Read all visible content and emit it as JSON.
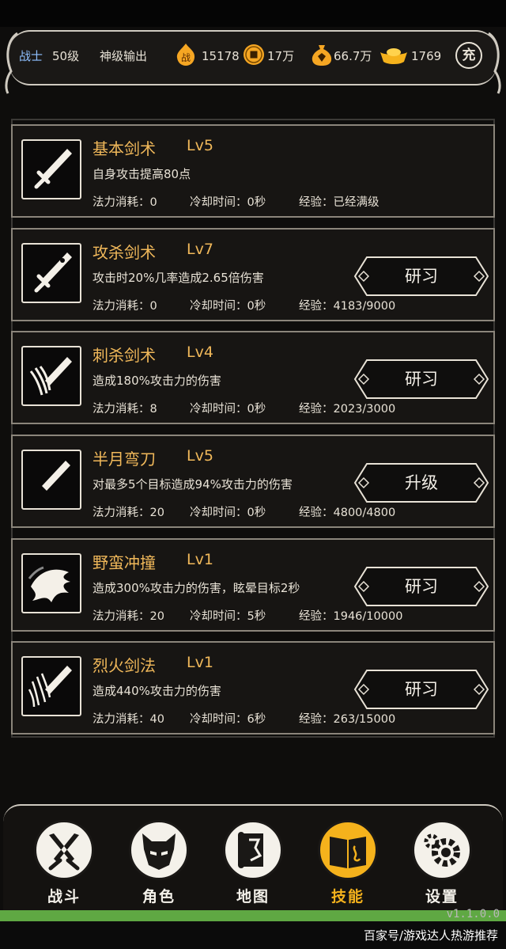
{
  "header": {
    "class": "战士",
    "level": "50级",
    "title": "神级输出",
    "battle_icon": "battle-power-icon",
    "battle_glyph": "战",
    "battle_power": "15178",
    "coin_icon": "coin-icon",
    "coins": "17万",
    "gem_icon": "gem-bag-icon",
    "gems": "66.7万",
    "ingot_icon": "gold-ingot-icon",
    "ingots": "1769",
    "recharge_label": "充"
  },
  "labels": {
    "mp": "法力消耗：",
    "cd": "冷却时间：",
    "exp": "经验："
  },
  "skills": [
    {
      "name": "基本剑术",
      "level": "Lv5",
      "desc": "自身攻击提高80点",
      "mp": "法力消耗：0",
      "cd": "冷却时间：0秒",
      "exp": "经验：已经满级",
      "button": "",
      "icon": "basic-sword-icon"
    },
    {
      "name": "攻杀剑术",
      "level": "Lv7",
      "desc": "攻击时20%几率造成2.65倍伤害",
      "mp": "法力消耗：0",
      "cd": "冷却时间：0秒",
      "exp": "经验：4183/9000",
      "button": "研习",
      "icon": "slaying-sword-icon"
    },
    {
      "name": "刺杀剑术",
      "level": "Lv4",
      "desc": "造成180%攻击力的伤害",
      "mp": "法力消耗：8",
      "cd": "冷却时间：0秒",
      "exp": "经验：2023/3000",
      "button": "研习",
      "icon": "thrust-sword-icon"
    },
    {
      "name": "半月弯刀",
      "level": "Lv5",
      "desc": "对最多5个目标造成94%攻击力的伤害",
      "mp": "法力消耗：20",
      "cd": "冷却时间：0秒",
      "exp": "经验：4800/4800",
      "button": "升级",
      "icon": "half-moon-blade-icon"
    },
    {
      "name": "野蛮冲撞",
      "level": "Lv1",
      "desc": "造成300%攻击力的伤害，眩晕目标2秒",
      "mp": "法力消耗：20",
      "cd": "冷却时间：5秒",
      "exp": "经验：1946/10000",
      "button": "研习",
      "icon": "barbaric-charge-icon"
    },
    {
      "name": "烈火剑法",
      "level": "Lv1",
      "desc": "造成440%攻击力的伤害",
      "mp": "法力消耗：40",
      "cd": "冷却时间：6秒",
      "exp": "经验：263/15000",
      "button": "研习",
      "icon": "flaming-sword-icon"
    }
  ],
  "nav": [
    {
      "label": "战斗",
      "icon": "crossed-swords-icon",
      "active": false
    },
    {
      "label": "角色",
      "icon": "helmet-icon",
      "active": false
    },
    {
      "label": "地图",
      "icon": "scroll-map-icon",
      "active": false
    },
    {
      "label": "技能",
      "icon": "skill-book-icon",
      "active": true
    },
    {
      "label": "设置",
      "icon": "gears-icon",
      "active": false
    }
  ],
  "version": "v1.1.0.0",
  "watermark": "百家号/游戏达人热游推荐",
  "colors": {
    "accent_gold": "#f0b85a",
    "active_tab": "#f5b21c",
    "class_blue": "#8fc0ff",
    "progress_green": "#5fa843"
  }
}
